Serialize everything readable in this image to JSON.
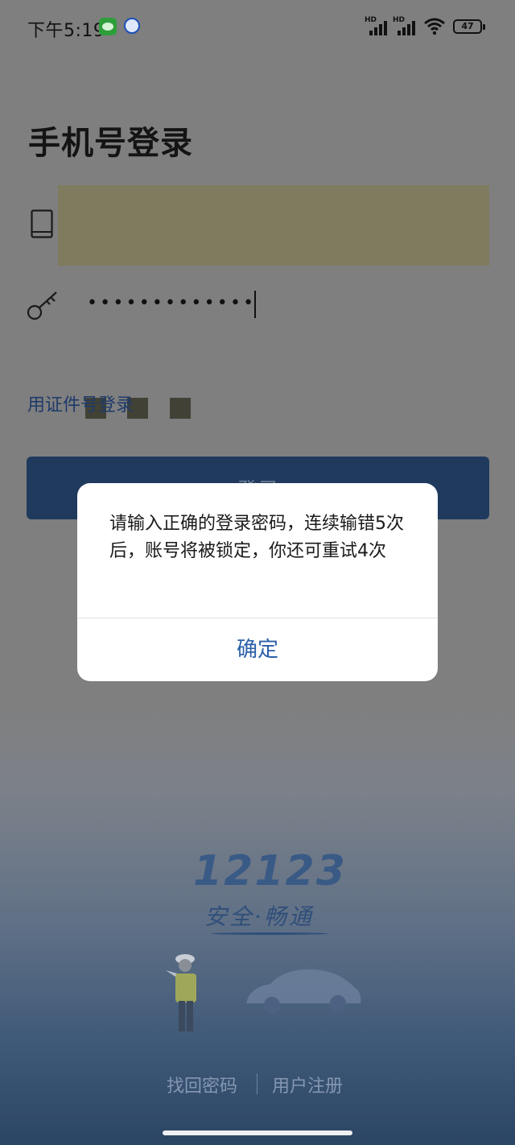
{
  "status_bar": {
    "time": "下午5:19",
    "signal1_label": "HD",
    "signal2_label": "HD",
    "battery": "47"
  },
  "login": {
    "title": "手机号登录",
    "phone_value": "■ ■ ■",
    "password_value": "•••••••••••••",
    "id_login_link": "用证件号登录",
    "login_button": "登录"
  },
  "logo": {
    "number": "12123",
    "slogan": "安全·畅通"
  },
  "bottom_links": {
    "recover_password": "找回密码",
    "register": "用户注册"
  },
  "dialog": {
    "message": "请输入正确的登录密码，连续输错5次后，账号将被锁定，你还可重试4次",
    "confirm": "确定"
  },
  "colors": {
    "overlay_gray": "#7f7f7f",
    "login_button": "#203a5e",
    "dialog_button_text": "#2a5fa8",
    "brand_blue": "#3a5a86"
  }
}
